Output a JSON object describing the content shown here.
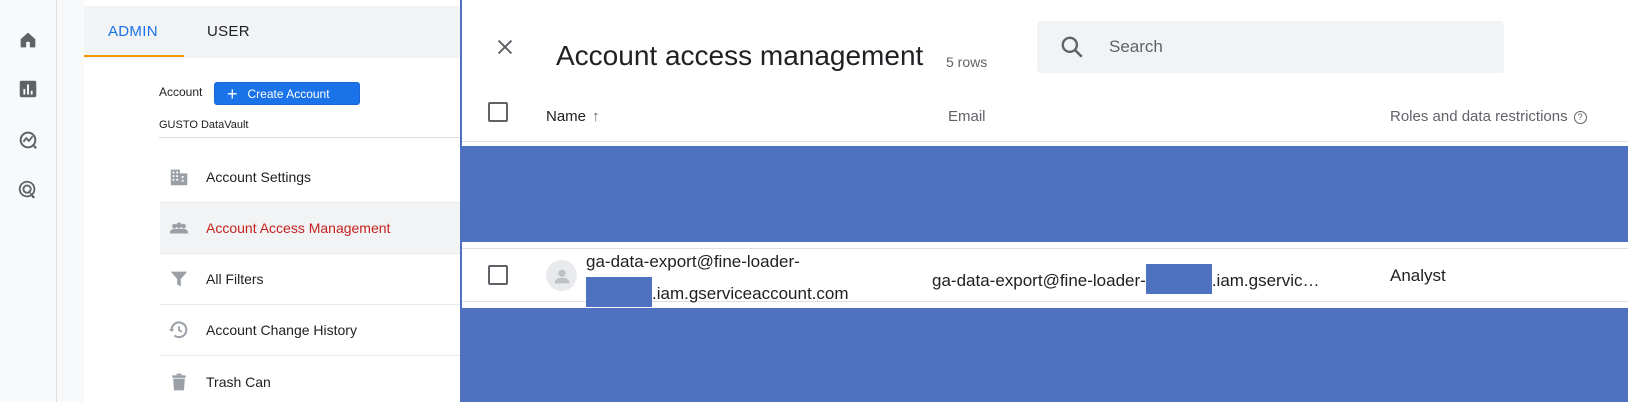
{
  "admin": {
    "tabs": [
      {
        "label": "ADMIN",
        "active": true
      },
      {
        "label": "USER",
        "active": false
      }
    ],
    "account_label": "Account",
    "create_account_label": "Create Account",
    "account_name": "GUSTO DataVault",
    "menu": [
      {
        "label": "Account Settings",
        "icon": "building-icon"
      },
      {
        "label": "Account Access Management",
        "icon": "people-icon",
        "active": true
      },
      {
        "label": "All Filters",
        "icon": "filter-icon"
      },
      {
        "label": "Account Change History",
        "icon": "history-icon"
      },
      {
        "label": "Trash Can",
        "icon": "trash-icon"
      }
    ]
  },
  "dialog": {
    "title": "Account access management",
    "row_count": "5 rows",
    "search_placeholder": "Search",
    "columns": {
      "name": "Name",
      "email": "Email",
      "roles": "Roles and data restrictions"
    },
    "rows": [
      {
        "name_line1": "ga-data-export@fine-loader-",
        "name_line2": ".iam.gserviceaccount.com",
        "email_prefix": "ga-data-export@fine-loader-",
        "email_suffix": ".iam.gservic…",
        "role": "Analyst"
      }
    ]
  },
  "colors": {
    "accent": "#1a73e8",
    "active_menu": "#c5221f",
    "tab_underline": "#f29900",
    "redaction": "#4f72c0"
  }
}
